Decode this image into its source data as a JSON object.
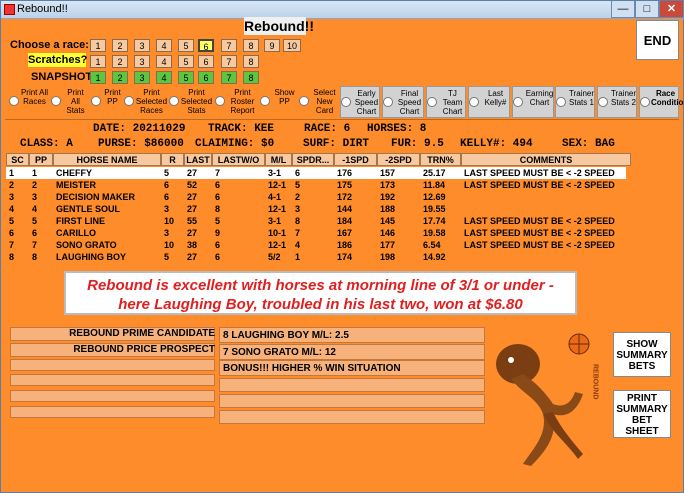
{
  "window": {
    "title": "Rebound!!"
  },
  "app": {
    "title": "Rebound!!",
    "end": "END"
  },
  "races": {
    "label": "Choose  a race:",
    "numbers": [
      "1",
      "2",
      "3",
      "4",
      "5",
      "6",
      "7",
      "8",
      "9",
      "10"
    ],
    "selected": "6"
  },
  "scratches": {
    "label": "Scratches?",
    "numbers": [
      "1",
      "2",
      "3",
      "4",
      "5",
      "6",
      "7",
      "8"
    ]
  },
  "snapshot": {
    "label": "SNAPSHOT",
    "numbers": [
      "1",
      "2",
      "3",
      "4",
      "5",
      "6",
      "7",
      "8"
    ]
  },
  "reports": [
    "Print All Races",
    "Print All Stats",
    "Print PP",
    "Print Selected Races",
    "Print Selected Stats",
    "Print Roster Report",
    "Show PP",
    "Select New Card",
    "Early Speed Chart",
    "Final Speed Chart",
    "TJ Team Chart",
    "Last Kelly#",
    "Earning Chart",
    "Trainer Stats 1",
    "Trainer Stats 2",
    "Race Conditions"
  ],
  "info": {
    "date": "DATE: 20211029",
    "track": "TRACK: KEE",
    "race": "RACE: 6",
    "horses": "HORSES: 8",
    "class": "CLASS: A",
    "purse": "PURSE: $86000",
    "claiming": "CLAIMING: $0",
    "surf": "SURF: DIRT",
    "fur": "FUR: 9.5",
    "kelly": "KELLY#: 494",
    "sex": "SEX: BAG"
  },
  "columns": [
    "SC",
    "PP",
    "HORSE NAME",
    "R",
    "LAST",
    "LASTW/O",
    "M/L",
    "SPDR...",
    "-1SPD",
    "-2SPD",
    "TRN%",
    "COMMENTS"
  ],
  "rows": [
    [
      "1",
      "1",
      "CHEFFY",
      "5",
      "27",
      "7",
      "3-1",
      "6",
      "176",
      "157",
      "25.17",
      "LAST SPEED MUST BE < -2 SPEED"
    ],
    [
      "2",
      "2",
      "MEISTER",
      "6",
      "52",
      "6",
      "12-1",
      "5",
      "175",
      "173",
      "11.84",
      "LAST SPEED MUST BE < -2 SPEED"
    ],
    [
      "3",
      "3",
      "DECISION MAKER",
      "6",
      "27",
      "6",
      "4-1",
      "2",
      "172",
      "192",
      "12.69",
      ""
    ],
    [
      "4",
      "4",
      "GENTLE SOUL",
      "3",
      "27",
      "8",
      "12-1",
      "3",
      "144",
      "188",
      "19.55",
      ""
    ],
    [
      "5",
      "5",
      "FIRST LINE",
      "10",
      "55",
      "5",
      "3-1",
      "8",
      "184",
      "145",
      "17.74",
      "LAST SPEED MUST BE < -2 SPEED"
    ],
    [
      "6",
      "6",
      "CARILLO",
      "3",
      "27",
      "9",
      "10-1",
      "7",
      "167",
      "146",
      "19.58",
      "LAST SPEED MUST BE < -2 SPEED"
    ],
    [
      "7",
      "7",
      "SONO GRATO",
      "10",
      "38",
      "6",
      "12-1",
      "4",
      "186",
      "177",
      "6.54",
      "LAST SPEED MUST BE < -2 SPEED"
    ],
    [
      "8",
      "8",
      "LAUGHING BOY",
      "5",
      "27",
      "6",
      "5/2",
      "1",
      "174",
      "198",
      "14.92",
      ""
    ]
  ],
  "overlay": {
    "line1": "Rebound is excellent with horses at morning line of 3/1 or under -",
    "line2": "here Laughing Boy, troubled in his last two, won at $6.80"
  },
  "prime": {
    "label": "REBOUND PRIME CANDIDATE",
    "value": "8  LAUGHING BOY    M/L: 2.5"
  },
  "price": {
    "label": "REBOUND PRICE PROSPECT",
    "value": "7  SONO GRATO       M/L: 12"
  },
  "bonus": "BONUS!!! HIGHER % WIN SITUATION",
  "logo_text": "REBOUND",
  "buttons": {
    "show": "SHOW SUMMARY BETS",
    "print": "PRINT SUMMARY BET SHEET"
  }
}
